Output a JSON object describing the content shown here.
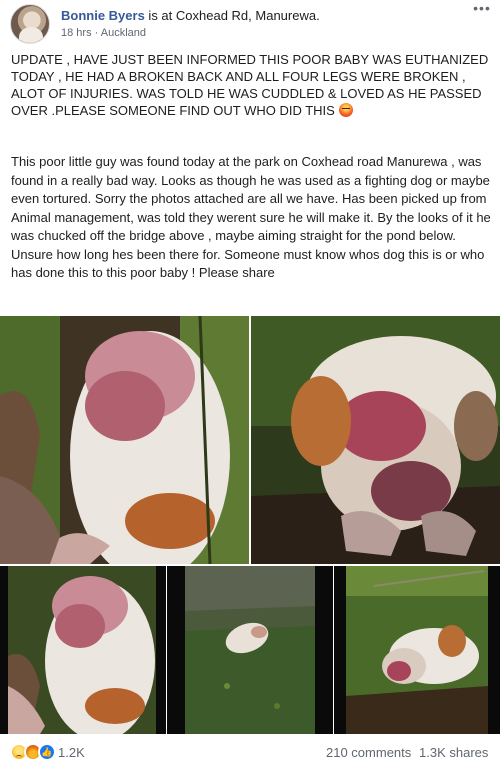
{
  "post": {
    "author": "Bonnie Byers",
    "checkin_prefix": " is at ",
    "location": "Coxhead Rd, Manurewa.",
    "time": "18 hrs",
    "separator": " · ",
    "place": "Auckland",
    "more_icon": "more-options-icon",
    "update_text": "UPDATE , HAVE JUST BEEN INFORMED THIS POOR BABY WAS EUTHANIZED TODAY , HE HAD A BROKEN BACK AND ALL FOUR LEGS WERE BROKEN , ALOT OF INJURIES. WAS TOLD HE WAS CUDDLED & LOVED AS HE PASSED OVER .PLEASE SOMEONE FIND OUT WHO DID THIS",
    "update_emoji": "angry-face-emoji",
    "story_text": "This poor little guy was found today at the park on Coxhead road Manurewa , was found in a really bad way. Looks as though he was used as a fighting dog or maybe even tortured. Sorry the photos attached are all we have. Has been picked up from Animal management, was told they werent sure he will make it. By the looks of it he was chucked off the bridge above , maybe aiming straight for the pond below. Unsure how long hes been there for. Someone must know whos dog this is or who has done this to this poor baby ! Please share"
  },
  "photos": [
    {
      "subject": "injured dog lying in grass, close up"
    },
    {
      "subject": "injured dog head resting on ground"
    },
    {
      "subject": "injured dog lying on side"
    },
    {
      "subject": "dog lying on grass, distant view"
    },
    {
      "subject": "dog lying on grass near tree roots"
    }
  ],
  "footer": {
    "reactions": [
      "sad",
      "angry",
      "like"
    ],
    "reaction_count": "1.2K",
    "comments": "210 comments",
    "shares": "1.3K shares"
  },
  "colors": {
    "author_link": "#385898",
    "muted_text": "#606770",
    "like_blue": "#1877f2"
  }
}
